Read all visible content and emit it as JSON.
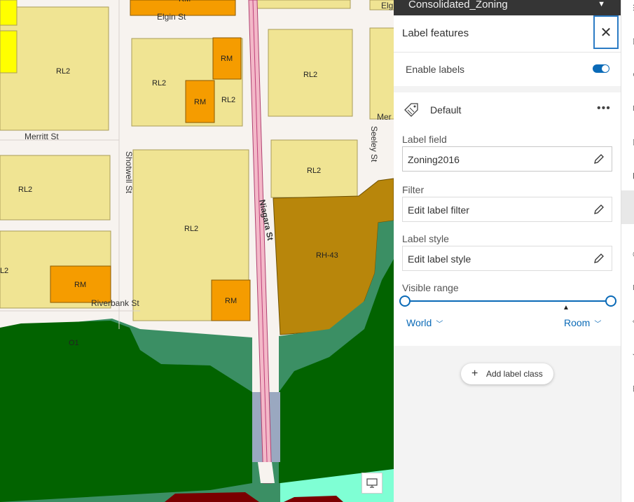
{
  "layer_bar": {
    "title": "Consolidated_Zoning"
  },
  "panel": {
    "title": "Label features",
    "enable_labels": "Enable labels",
    "enabled": true,
    "label_class": {
      "name": "Default",
      "label_field_title": "Label field",
      "label_field_value": "Zoning2016",
      "filter_title": "Filter",
      "filter_value": "Edit label filter",
      "style_title": "Label style",
      "style_value": "Edit label style",
      "range_title": "Visible range",
      "range_min": "World",
      "range_max": "Room"
    },
    "add_label_class": "Add label class"
  },
  "map": {
    "zone_labels": [
      "RL2",
      "RL2",
      "RM",
      "RM",
      "RL2",
      "RL2",
      "RL2",
      "RL2",
      "RL2",
      "RL2",
      "RM",
      "RM",
      "RH-43",
      "O1",
      "RL2"
    ],
    "streets": [
      "Elgin St",
      "Elg",
      "Merritt St",
      "Mer",
      "Seeley St",
      "Shotwell St",
      "Niagara St",
      "Riverbank St"
    ],
    "top_label": "RM"
  },
  "colors": {
    "accent": "#0a6ab7",
    "residential_low": "#f0e493",
    "residential_medium": "#f59c00",
    "residential_high": "#b8860b",
    "open_space": "#026300",
    "open_space_light": "#3b8f64"
  }
}
